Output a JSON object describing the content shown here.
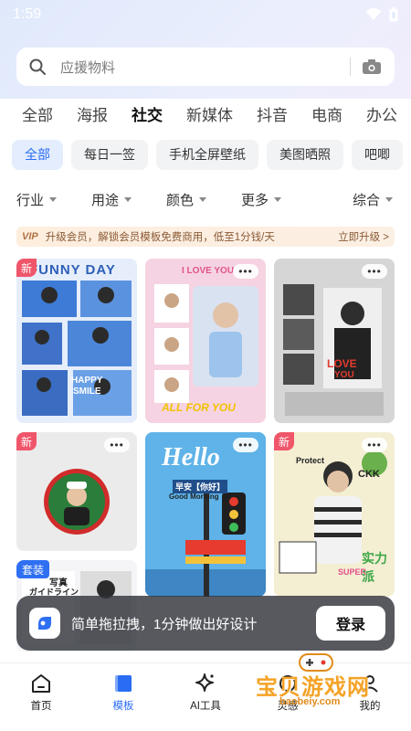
{
  "status_bar": {
    "time": "1:59"
  },
  "search": {
    "placeholder": "应援物料"
  },
  "tabs": [
    {
      "label": "全部"
    },
    {
      "label": "海报"
    },
    {
      "label": "社交",
      "active": true
    },
    {
      "label": "新媒体"
    },
    {
      "label": "抖音"
    },
    {
      "label": "电商"
    },
    {
      "label": "办公"
    }
  ],
  "chips": [
    {
      "label": "全部",
      "active": true
    },
    {
      "label": "每日一签"
    },
    {
      "label": "手机全屏壁纸"
    },
    {
      "label": "美图晒照"
    },
    {
      "label": "吧唧"
    }
  ],
  "filters": {
    "industry": "行业",
    "usage": "用途",
    "color": "颜色",
    "more": "更多",
    "sort": "综合"
  },
  "vip_banner": {
    "badge": "VIP",
    "text": "升级会员，解锁会员模板免费商用，低至1分钱/天",
    "action": "立即升级 >"
  },
  "cards": {
    "new_label": "新",
    "more_label": "•••",
    "suit_label": "套装",
    "card1": {
      "headline": "FUNNY DAY",
      "line1": "HAPPY",
      "line2": "SMILE"
    },
    "card2": {
      "headline": "I LOVE YOU",
      "footer": "ALL FOR YOU"
    },
    "card3": {
      "line1": "LOVE",
      "line2": "YOU"
    },
    "card5": {
      "headline": "Hello",
      "sub": "早安【你好】",
      "morning": "Good Morning"
    },
    "card6": {
      "headline": "CKK",
      "line1": "SUPER",
      "line2": "实力派",
      "line3": "Protect"
    },
    "card7": {
      "line1": "写真",
      "line2": "ガイドライン"
    }
  },
  "login_bar": {
    "text": "简单拖拉拽，1分钟做出好设计",
    "button": "登录"
  },
  "bottom_nav": [
    {
      "label": "首页"
    },
    {
      "label": "模板",
      "active": true
    },
    {
      "label": "AI工具"
    },
    {
      "label": "灵感"
    },
    {
      "label": "我的"
    }
  ],
  "watermark": {
    "title": "宝贝游戏网",
    "url": "baobeiy.com"
  },
  "colors": {
    "accent": "#2a6df4",
    "new_tag": "#f0566a",
    "vip_text": "#8a5a36"
  }
}
